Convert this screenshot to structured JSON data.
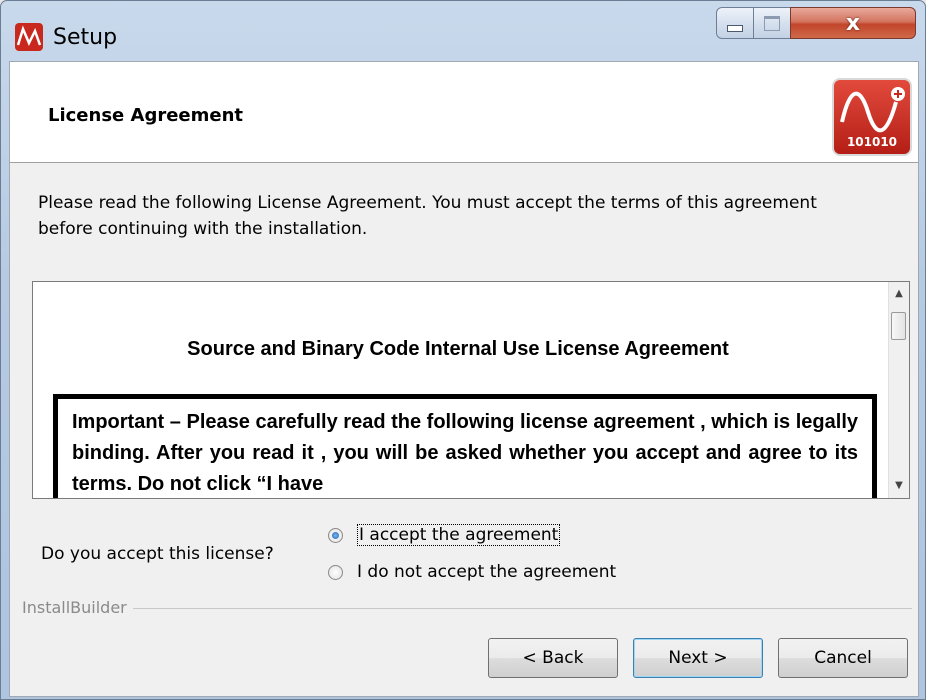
{
  "window": {
    "title": "Setup",
    "close_glyph": "x"
  },
  "header": {
    "title": "License Agreement",
    "logo_text": "101010"
  },
  "intro_text": "Please read the following License Agreement. You must accept the terms of this agreement before continuing with the installation.",
  "license": {
    "heading": "Source and Binary Code Internal Use License Agreement",
    "body": "Important – Please carefully read the following license agreement , which is legally binding.  After you read it  , you will be asked whether you accept and agree to its terms.   Do not click  “I have"
  },
  "acceptance": {
    "question": "Do you accept this license?",
    "options": [
      {
        "label": "I accept the agreement",
        "selected": true
      },
      {
        "label": "I do not accept the agreement",
        "selected": false
      }
    ]
  },
  "branding": "InstallBuilder",
  "buttons": {
    "back": "< Back",
    "next": "Next >",
    "cancel": "Cancel"
  },
  "scroll": {
    "up": "▲",
    "down": "▼"
  },
  "colors": {
    "logo_red": "#c8281e",
    "accent": "#3c7fb1"
  }
}
